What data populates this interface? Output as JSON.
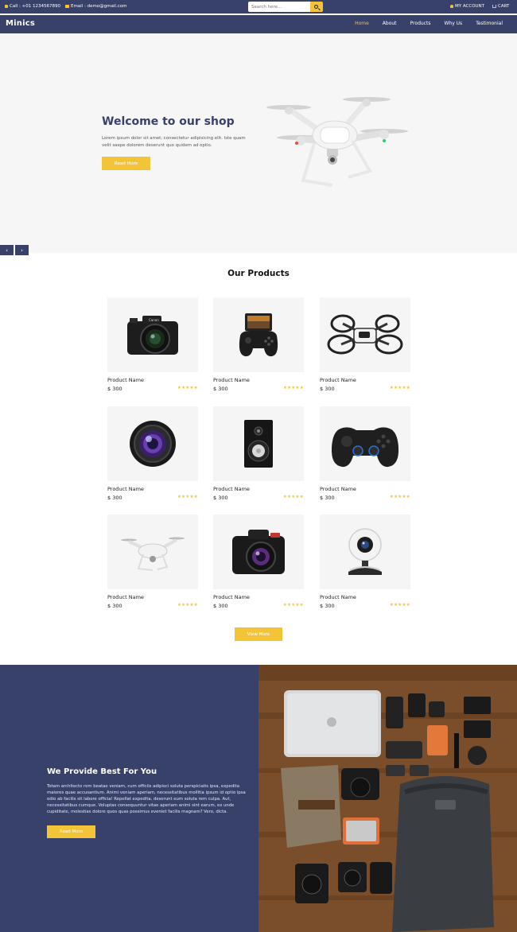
{
  "topbar": {
    "call": "Call : +01 1234567890",
    "email": "Email : demo@gmail.com",
    "search_placeholder": "Search here...",
    "account": "MY ACCOUNT",
    "cart": "CART"
  },
  "nav": {
    "logo": "Minics",
    "items": [
      "Home",
      "About",
      "Products",
      "Why Us",
      "Testimonial"
    ],
    "active": "Home"
  },
  "hero": {
    "title": "Welcome to our shop",
    "text": "Lorem ipsum dolor sit amet, consectetur adipisicing elit. Iste quam velit saepe dolorem deserunt quo quidem ad optio.",
    "button": "Read More",
    "prev": "‹",
    "next": "›"
  },
  "products": {
    "title": "Our Products",
    "items": [
      {
        "name": "Product Name",
        "price": "$ 300",
        "rating": 5,
        "icon": "dslr-camera"
      },
      {
        "name": "Product Name",
        "price": "$ 300",
        "rating": 5,
        "icon": "phone-game-controller"
      },
      {
        "name": "Product Name",
        "price": "$ 300",
        "rating": 5,
        "icon": "mini-drone"
      },
      {
        "name": "Product Name",
        "price": "$ 300",
        "rating": 5,
        "icon": "camera-lens"
      },
      {
        "name": "Product Name",
        "price": "$ 300",
        "rating": 5,
        "icon": "speaker"
      },
      {
        "name": "Product Name",
        "price": "$ 300",
        "rating": 5,
        "icon": "gamepad"
      },
      {
        "name": "Product Name",
        "price": "$ 300",
        "rating": 5,
        "icon": "drone"
      },
      {
        "name": "Product Name",
        "price": "$ 300",
        "rating": 5,
        "icon": "camera"
      },
      {
        "name": "Product Name",
        "price": "$ 300",
        "rating": 5,
        "icon": "webcam"
      }
    ],
    "view_more": "View More"
  },
  "about": {
    "title": "We Provide Best For You",
    "text": "Totam architecto rem beatae veniam, cum officiis adipisci soluta perspiciatis ipsa, expedita maiores quae accusantium. Animi veniam aperiam, necessitatibus mollitia ipsum id optio ipsa odio ab facilis sit labore officia! Repellat expedita, deserunt eum soluta rem culpa. Aut, necessitatibus cumque. Voluptas consequuntur vitae aperiam animi sint earum, ex unde cupiditate, molestias dolore quos quas possimus eveniet facilis magnam? Vero, dicta.",
    "button": "Read More"
  },
  "colors": {
    "primary": "#38416a",
    "accent": "#f3c338",
    "hero_bg": "#f6f6f6",
    "card_bg": "#f5f5f5"
  }
}
